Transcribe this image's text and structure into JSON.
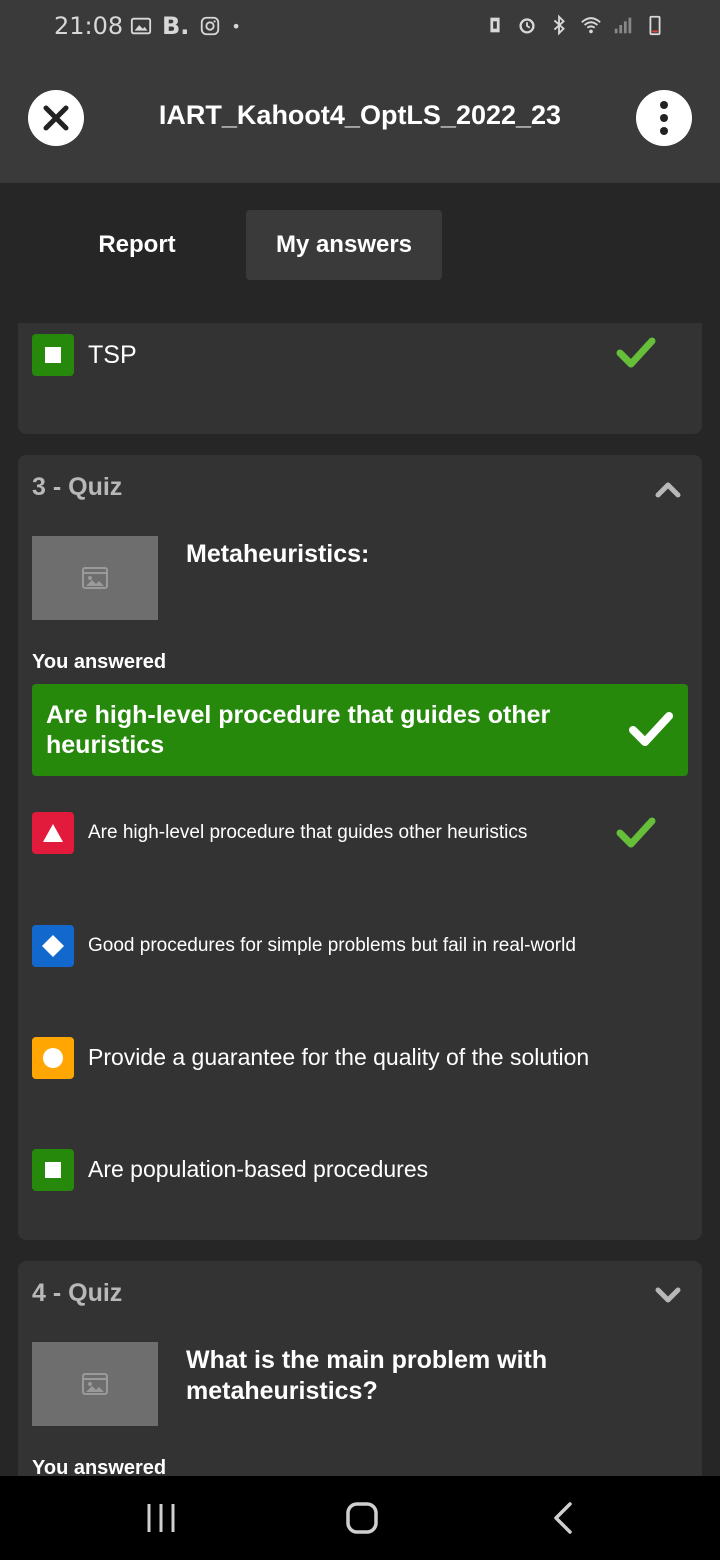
{
  "status_bar": {
    "time": "21:08",
    "brand_letter": "B.",
    "dot": "•",
    "icons_left": [
      "image-icon",
      "instagram-icon"
    ],
    "icons_right": [
      "battery-saver-icon",
      "alarm-icon",
      "bluetooth-icon",
      "wifi-icon",
      "signal-icon",
      "battery-icon"
    ]
  },
  "header": {
    "title": "IART_Kahoot4_OptLS_2022_23",
    "close_icon": "close-icon",
    "more_icon": "more-vertical-icon"
  },
  "tabs": [
    {
      "label": "Report",
      "active": false
    },
    {
      "label": "My answers",
      "active": true
    }
  ],
  "previous_card": {
    "option": {
      "shape": "square",
      "color": "#26890c",
      "text": "TSP",
      "correct": true
    }
  },
  "quiz3": {
    "title": "3 - Quiz",
    "expanded": true,
    "question": "Metaheuristics:",
    "you_answered_label": "You answered",
    "answer": "Are high-level procedure that guides other heuristics",
    "answer_correct": true,
    "options": [
      {
        "shape": "triangle",
        "color": "#e21b3c",
        "text": "Are high-level procedure that guides other heuristics",
        "correct": true
      },
      {
        "shape": "diamond",
        "color": "#1368ce",
        "text": "Good procedures for simple problems but fail in real-world",
        "correct": false
      },
      {
        "shape": "circle",
        "color": "#ffa602",
        "text": "Provide a guarantee for the quality of the solution",
        "correct": false
      },
      {
        "shape": "square",
        "color": "#26890c",
        "text": "Are population-based procedures",
        "correct": false
      }
    ]
  },
  "quiz4": {
    "title": "4 - Quiz",
    "expanded": false,
    "question": "What is the main problem with metaheuristics?",
    "you_answered_label": "You answered"
  },
  "colors": {
    "background": "#262626",
    "card": "#333333",
    "header": "#3a3a3a",
    "correct_green": "#26890c",
    "check_green": "#66bf39"
  },
  "nav_bar": {
    "icons": [
      "recent-apps-icon",
      "home-icon",
      "back-icon"
    ]
  }
}
